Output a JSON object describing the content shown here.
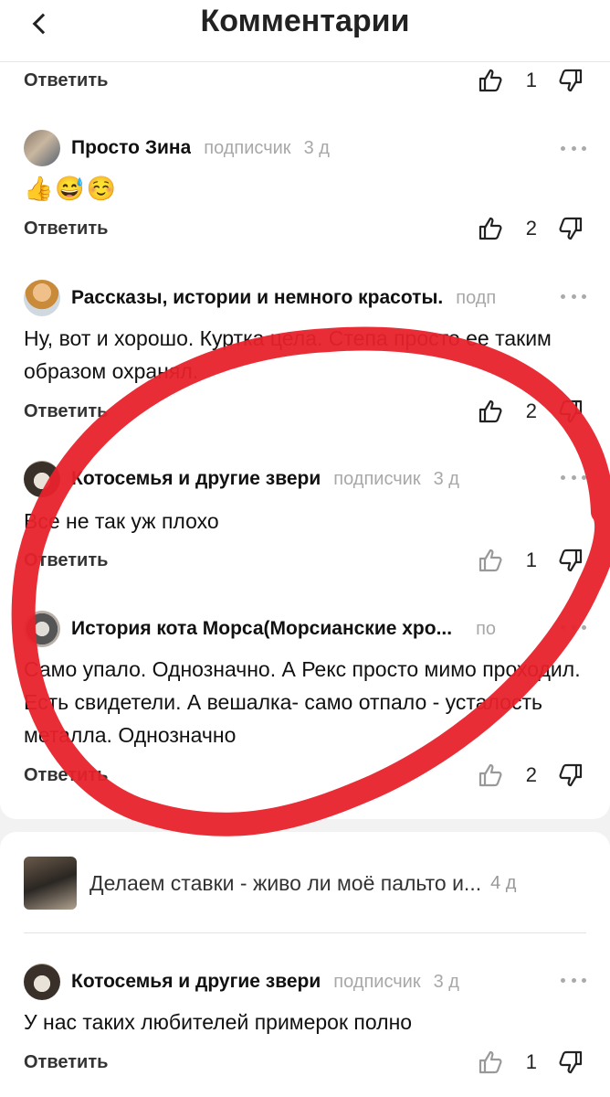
{
  "header": {
    "title": "Комментарии",
    "back_icon": "chevron-left-icon"
  },
  "top_row": {
    "reply": "Ответить",
    "likes": "1"
  },
  "comments": [
    {
      "author": "Просто Зина",
      "role": "подписчик",
      "time": "3 д",
      "text": "👍😅☺️",
      "reply": "Ответить",
      "likes": "2"
    },
    {
      "author": "Рассказы, истории и немного красоты.",
      "role": "подп",
      "time": "",
      "text": "Ну, вот и хорошо. Куртка цела. Степа просто ее таким образом охранял.",
      "reply": "Ответить",
      "likes": "2"
    },
    {
      "author": "Котосемья и другие звери",
      "role": "подписчик",
      "time": "3 д",
      "text": "Все не так уж плохо",
      "reply": "Ответить",
      "likes": "1"
    },
    {
      "author": "История кота Морса(Морсианские хро...",
      "role": "по",
      "time": "",
      "text": "Само упало. Однозначно. А Рекс просто мимо проходил. Есть свидетели. А вешалка- само отпало - усталость металла. Однозначно",
      "reply": "Ответить",
      "likes": "2"
    }
  ],
  "thread": {
    "title": "Делаем ставки - живо ли моё пальто и...",
    "time": "4 д"
  },
  "thread_comment": {
    "author": "Котосемья и другие звери",
    "role": "подписчик",
    "time": "3 д",
    "text": "У нас таких любителей примерок полно",
    "reply": "Ответить",
    "likes": "1"
  },
  "colors": {
    "annotation": "#e8222b",
    "muted": "#a8a8a8",
    "background": "#f2f2f2"
  }
}
